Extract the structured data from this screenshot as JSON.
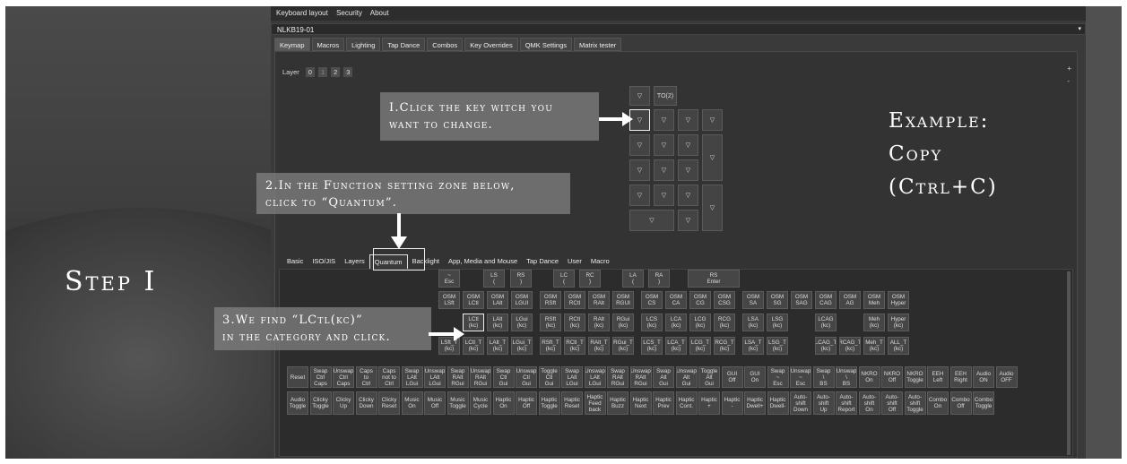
{
  "menu": [
    "Keyboard layout",
    "Security",
    "About"
  ],
  "keyboard_name": "NLKB19-01",
  "tabs": [
    "Keymap",
    "Macros",
    "Lighting",
    "Tap Dance",
    "Combos",
    "Key Overrides",
    "QMK Settings",
    "Matrix tester"
  ],
  "layer": {
    "label": "Layer",
    "items": [
      "0",
      "1",
      "2",
      "3"
    ]
  },
  "zoom": {
    "plus": "+",
    "minus": "-"
  },
  "keymap_keys": [
    "▽",
    "TO(2)",
    "▽",
    "▽",
    "▽",
    "▽",
    "▽",
    "▽",
    "▽",
    "▽",
    "▽",
    "▽",
    "▽",
    "▽",
    "▽",
    "▽",
    "▽",
    "▽",
    "▽",
    "▽"
  ],
  "function_tabs": [
    "Basic",
    "ISO/JIS",
    "Layers",
    "Quantum",
    "Backlight",
    "App, Media and Mouse",
    "Tap Dance",
    "User",
    "Macro"
  ],
  "quantum_rows": {
    "row0": [
      "~\nEsc",
      "LS\n(",
      "RS\n)",
      "LC\n(",
      "RC\n)",
      "LA\n(",
      "RA\n)",
      "RS\nEnter"
    ],
    "row1": [
      "OSM\nLSft",
      "OSM\nLCtl",
      "OSM\nLAlt",
      "OSM\nLGUI",
      "OSM\nRSft",
      "OSM\nRCtl",
      "OSM\nRAlt",
      "OSM\nRGUI",
      "OSM\nCS",
      "OSM\nCA",
      "OSM\nCG",
      "OSM\nCSG",
      "OSM\nSA",
      "OSM\nSG",
      "OSM\nSAG",
      "OSM\nCAG",
      "OSM\nAG",
      "OSM\nMeh",
      "OSM\nHyper"
    ],
    "row2": [
      "LCtl\n(kc)",
      "LAlt\n(kc)",
      "LGui\n(kc)",
      "RSft\n(kc)",
      "RCtl\n(kc)",
      "RAlt\n(kc)",
      "RGui\n(kc)",
      "LCS\n(kc)",
      "LCA\n(kc)",
      "LCG\n(kc)",
      "RCG\n(kc)",
      "LSA\n(kc)",
      "LSG\n(kc)",
      "LCAG\n(kc)",
      "Meh\n(kc)",
      "Hyper\n(kc)"
    ],
    "row3": [
      "LSft_T\n(kc)",
      "LCtl_T\n(kc)",
      "LAlt_T\n(kc)",
      "LGui_T\n(kc)",
      "RSft_T\n(kc)",
      "RCtl_T\n(kc)",
      "RAlt_T\n(kc)",
      "RGui_T\n(kc)",
      "LCS_T\n(kc)",
      "LCA_T\n(kc)",
      "LCG_T\n(kc)",
      "RCG_T\n(kc)",
      "LSA_T\n(kc)",
      "LSG_T\n(kc)",
      "LCAG_T\n(kc)",
      "RCAG_T\n(kc)",
      "Meh_T\n(kc)",
      "ALL_T\n(kc)"
    ],
    "row4": [
      "Reset",
      "Swap\nCtrl\nCaps",
      "Unswap\nCtrl\nCaps",
      "Caps\nto\nCtrl",
      "Caps\nnot to\nCtrl",
      "Swap\nLAlt\nLGui",
      "Unswap\nLAlt\nLGui",
      "Swap\nRAlt\nRGui",
      "Unswap\nRAlt\nRGui",
      "Swap\nCtl\nGui",
      "Unswap\nCtl\nGui",
      "Toggle\nCtl\nGui",
      "Swap\nLAlt\nLGui",
      "Unswap\nLAlt\nLGui",
      "Swap\nRAlt\nRGui",
      "Unswap\nRAlt\nRGui",
      "Swap\nAlt\nGui",
      "Unswap\nAlt\nGui",
      "Toggle\nAlt\nGui",
      "GUI\nOff",
      "GUI\nOn",
      "Swap\n~\nEsc",
      "Unswap\n~\nEsc",
      "Swap\n\\\nBS",
      "Unswap\n\\\nBS",
      "NKRO\nOn",
      "NKRO\nOff",
      "NKRO\nToggle",
      "EEH\nLeft",
      "EEH\nRight",
      "Audio\nON",
      "Audio\nOFF"
    ],
    "row5": [
      "Audio\nToggle",
      "Clicky\nToggle",
      "Clicky\nUp",
      "Clicky\nDown",
      "Clicky\nReset",
      "Music\nOn",
      "Music\nOff",
      "Music\nToggle",
      "Music\nCycle",
      "Haptic\nOn",
      "Haptic\nOff",
      "Haptic\nToggle",
      "Haptic\nReset",
      "Haptic\nFeed\nback",
      "Haptic\nBuzz",
      "Haptic\nNext",
      "Haptic\nPrev",
      "Haptic\nCont.",
      "Haptic\n+",
      "Haptic\n-",
      "Haptic\nDwell+",
      "Haptic\nDwell-",
      "Auto-\nshift\nDown",
      "Auto-\nshift\nUp",
      "Auto-\nshift\nReport",
      "Auto-\nshift\nOn",
      "Auto-\nshift\nOff",
      "Auto-\nshift\nToggle",
      "Combo\nOn",
      "Combo\nOff",
      "Combo\nToggle"
    ]
  },
  "annotations": {
    "step_title": "Step I",
    "a1_line1": "I.Click the key witch you",
    "a1_line2": "want to change.",
    "a2_line1": "2.In the Function setting zone below,",
    "a2_line2": "click to “Quantum”.",
    "a3_line1": "3.We find “LCtl(kc)”",
    "a3_line2": "in the category and click.",
    "example_line1": "Example:",
    "example_line2": "Copy",
    "example_line3": "(Ctrl+C)"
  }
}
